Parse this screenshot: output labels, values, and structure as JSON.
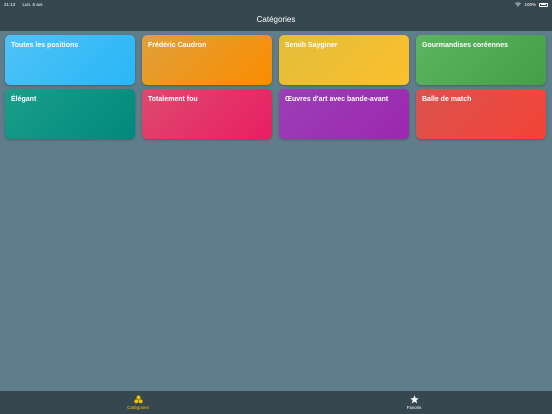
{
  "status_bar": {
    "time": "21:13",
    "date": "Lun. 6 avr.",
    "battery": "100%"
  },
  "nav": {
    "title": "Catégories"
  },
  "categories": [
    {
      "label": "Toutes les positions",
      "from": "#4fc3f7",
      "to": "#29b6f6"
    },
    {
      "label": "Frédéric Caudron",
      "from": "#e0a03a",
      "to": "#fb8c00"
    },
    {
      "label": "Semih Sayginer",
      "from": "#e2bd3a",
      "to": "#fbc02d"
    },
    {
      "label": "Gourmandises coréennes",
      "from": "#5cb560",
      "to": "#43a047"
    },
    {
      "label": "Élégant",
      "from": "#1b9e8c",
      "to": "#00897b"
    },
    {
      "label": "Totalement fou",
      "from": "#dd4a6e",
      "to": "#e91e63"
    },
    {
      "label": "Œuvres d'art avec bande-avant",
      "from": "#9c3fb5",
      "to": "#9c27b0"
    },
    {
      "label": "Balle de match",
      "from": "#d9534f",
      "to": "#f44336"
    }
  ],
  "tabs": {
    "categories_label": "Catégories",
    "favorites_label": "Favoris",
    "active_color": "#f2c200"
  }
}
